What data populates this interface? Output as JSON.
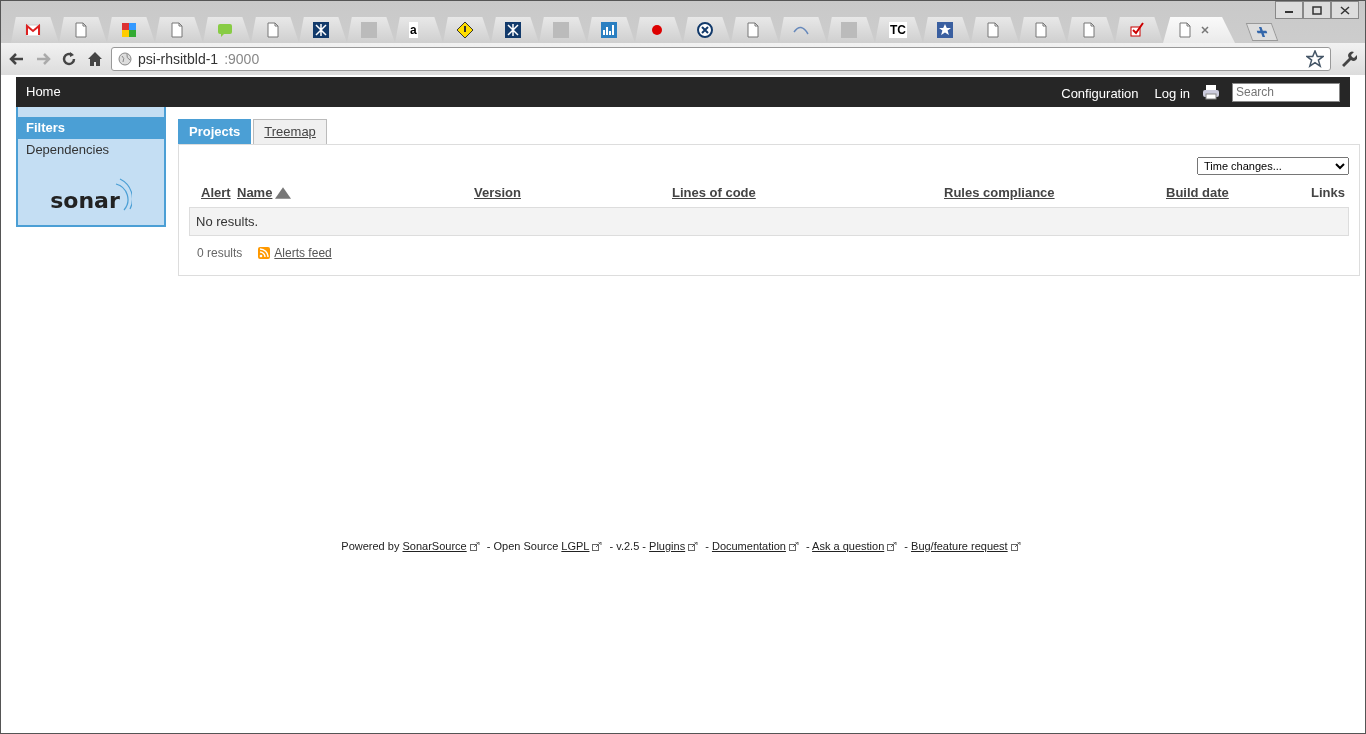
{
  "browser": {
    "tabs": [
      {
        "kind": "mail",
        "selected": false
      },
      {
        "kind": "page",
        "selected": false
      },
      {
        "kind": "blocks",
        "selected": false
      },
      {
        "kind": "page",
        "selected": false
      },
      {
        "kind": "chat",
        "selected": false
      },
      {
        "kind": "page",
        "selected": false
      },
      {
        "kind": "cross",
        "selected": false
      },
      {
        "kind": "portrait",
        "selected": false
      },
      {
        "kind": "letter",
        "glyph": "a",
        "selected": false
      },
      {
        "kind": "warning",
        "selected": false
      },
      {
        "kind": "cross",
        "selected": false
      },
      {
        "kind": "portrait",
        "selected": false
      },
      {
        "kind": "chart",
        "selected": false
      },
      {
        "kind": "blob",
        "selected": false
      },
      {
        "kind": "figure",
        "selected": false
      },
      {
        "kind": "page",
        "selected": false
      },
      {
        "kind": "arc",
        "selected": false
      },
      {
        "kind": "portrait",
        "selected": false
      },
      {
        "kind": "letter",
        "glyph": "TC",
        "selected": false
      },
      {
        "kind": "star",
        "selected": false
      },
      {
        "kind": "page",
        "selected": false
      },
      {
        "kind": "page",
        "selected": false
      },
      {
        "kind": "page",
        "selected": false
      },
      {
        "kind": "check",
        "selected": false
      },
      {
        "kind": "page",
        "selected": true
      }
    ],
    "address": {
      "host": "psi-rhsitbld-1",
      "port": ":9000"
    }
  },
  "header": {
    "home": "Home",
    "links": [
      "Configuration",
      "Log in"
    ],
    "search": {
      "placeholder": "Search"
    }
  },
  "sidebar": {
    "items": [
      {
        "label": "Filters",
        "selected": true
      },
      {
        "label": "Dependencies",
        "selected": false
      }
    ],
    "logo": "sonar"
  },
  "tabs": [
    {
      "label": "Projects",
      "selected": true
    },
    {
      "label": "Treemap",
      "selected": false
    }
  ],
  "period_select": "Time changes...",
  "table": {
    "columns": [
      {
        "label": "Alert",
        "link": true,
        "sorted": false
      },
      {
        "label": "Name",
        "link": true,
        "sorted": true
      },
      {
        "label": "Version",
        "link": true,
        "sorted": false
      },
      {
        "label": "Lines of code",
        "link": true,
        "sorted": false
      },
      {
        "label": "Rules compliance",
        "link": true,
        "sorted": false
      },
      {
        "label": "Build date",
        "link": true,
        "sorted": false
      },
      {
        "label": "Links",
        "link": false,
        "sorted": false
      }
    ],
    "empty_message": "No results."
  },
  "results_count": "0 results",
  "alerts_feed": "Alerts feed",
  "footer": [
    {
      "kind": "text",
      "text": "Powered by"
    },
    {
      "kind": "link",
      "text": "SonarSource"
    },
    {
      "kind": "text",
      "text": "- Open Source"
    },
    {
      "kind": "link",
      "text": "LGPL"
    },
    {
      "kind": "text",
      "text": "- v.2.5 -"
    },
    {
      "kind": "link",
      "text": "Plugins"
    },
    {
      "kind": "text",
      "text": "-"
    },
    {
      "kind": "link",
      "text": "Documentation"
    },
    {
      "kind": "text",
      "text": "-"
    },
    {
      "kind": "link",
      "text": "Ask a question"
    },
    {
      "kind": "text",
      "text": "-"
    },
    {
      "kind": "link",
      "text": "Bug/feature request"
    }
  ]
}
